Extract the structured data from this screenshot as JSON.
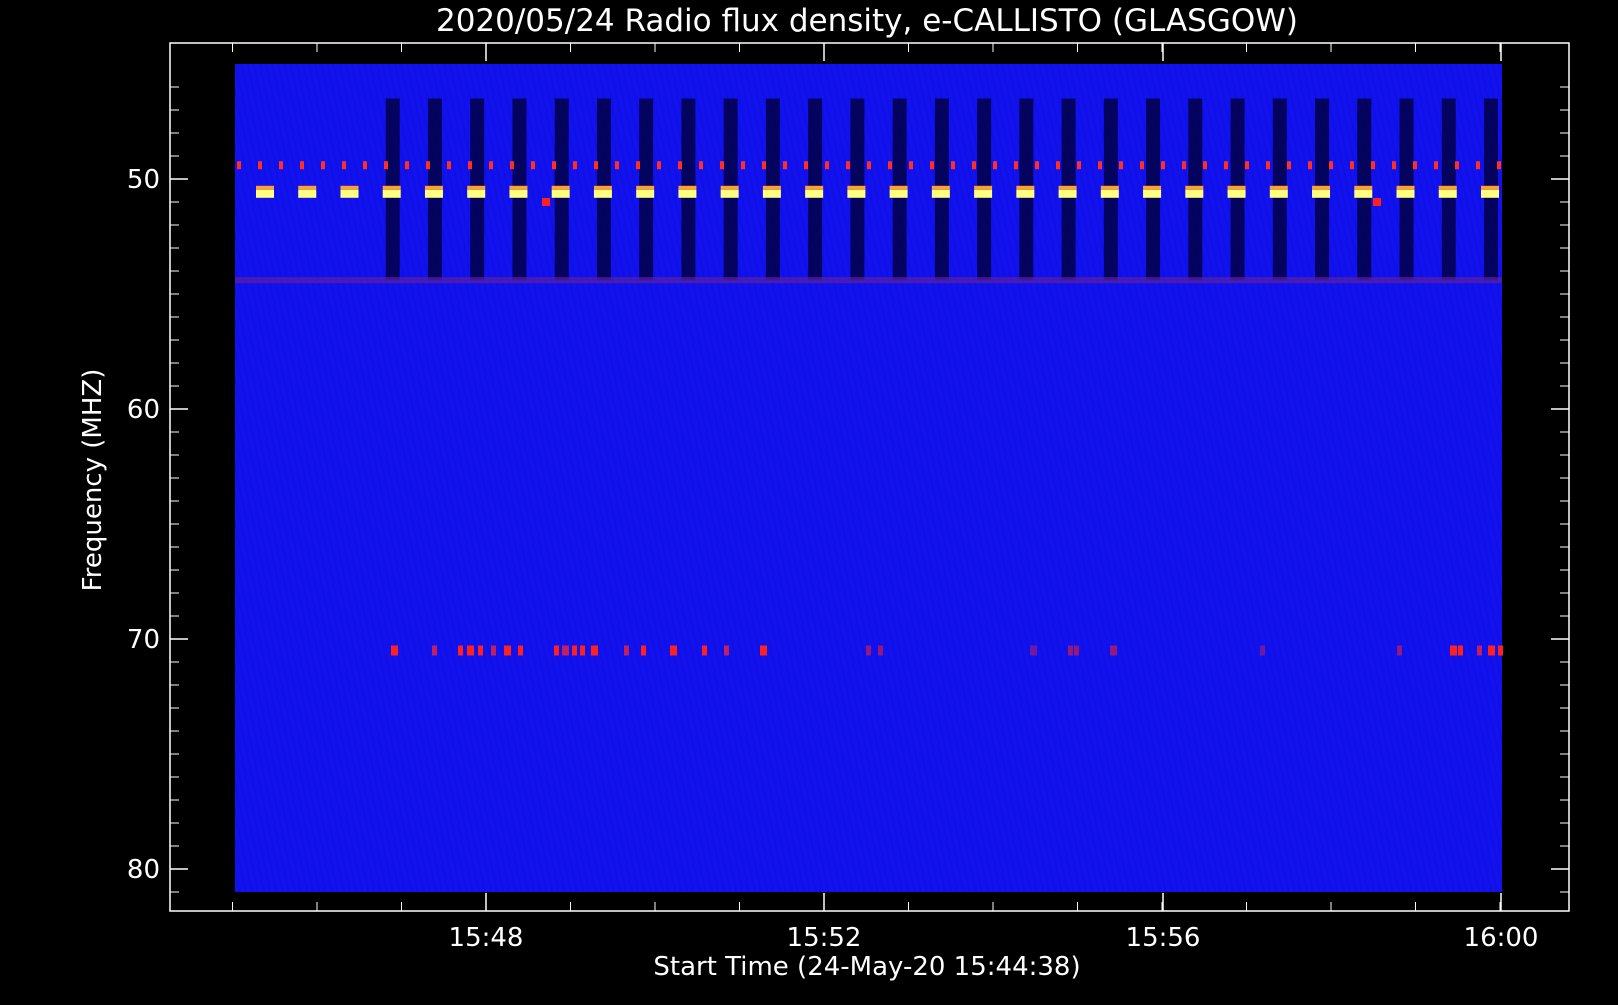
{
  "chart_data": {
    "type": "heatmap",
    "title": "2020/05/24  Radio flux density, e-CALLISTO (GLASGOW)",
    "xlabel": "Start Time (24-May-20 15:44:38)",
    "ylabel": "Frequency (MHZ)",
    "x_ticks": [
      "15:48",
      "15:52",
      "15:56",
      "16:00"
    ],
    "y_ticks": [
      50,
      60,
      70,
      80
    ],
    "y_axis_inverted": true,
    "ylim": [
      45,
      82
    ],
    "data_extent": {
      "freq_min_mhz": 45,
      "freq_max_mhz": 81
    },
    "background_color": "#1010f0",
    "colors": {
      "axis": "#ffffff",
      "hot": "#ff2020",
      "hotter": "#ffff80",
      "dark": "#000030"
    },
    "bands": [
      {
        "name": "dotted interference line",
        "freq_mhz": 49.4,
        "color": "#ff3020"
      },
      {
        "name": "bright periodic blocks",
        "freq_mhz": 50.6,
        "color": "#ffff80"
      },
      {
        "name": "band edge",
        "freq_mhz": 54.4,
        "color": "#6020a0"
      },
      {
        "name": "intermittent interference",
        "freq_mhz": 70.5,
        "color": "#ff2020"
      }
    ],
    "periodic_pulse_count": 30
  }
}
